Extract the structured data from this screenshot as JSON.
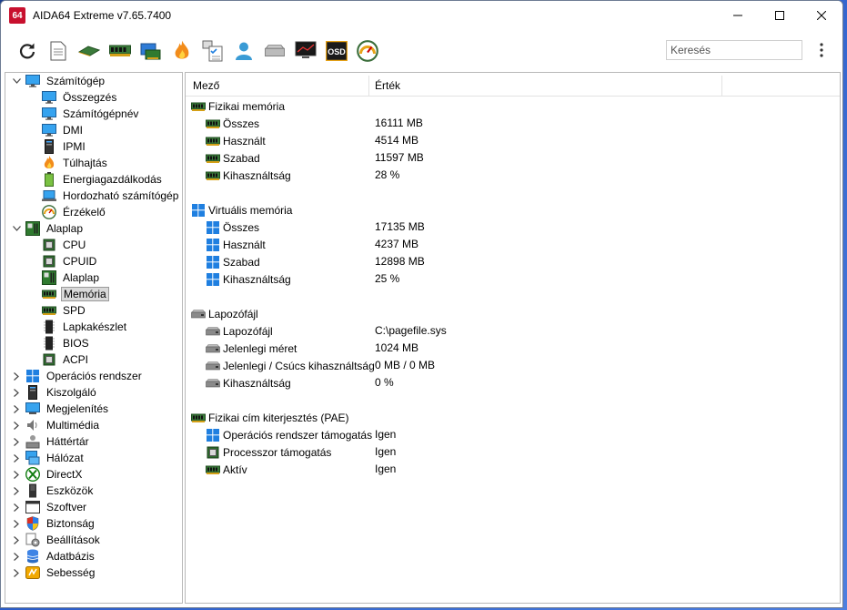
{
  "window": {
    "title": "AIDA64 Extreme v7.65.7400",
    "logo_text": "64"
  },
  "toolbar": {
    "buttons": [
      "refresh-icon",
      "report-icon",
      "motherboard-icon",
      "memory-icon",
      "network-card-icon",
      "flame-icon",
      "network-audit-icon",
      "user-icon",
      "drive-icon",
      "monitor-icon",
      "osd-icon",
      "gauge-icon"
    ],
    "search_placeholder": "Keresés"
  },
  "tree": {
    "items": [
      {
        "label": "Számítógép",
        "level": 0,
        "expand": "open",
        "icon": "computer-icon"
      },
      {
        "label": "Összegzés",
        "level": 1,
        "icon": "computer-icon"
      },
      {
        "label": "Számítógépnév",
        "level": 1,
        "icon": "computer-icon"
      },
      {
        "label": "DMI",
        "level": 1,
        "icon": "computer-icon"
      },
      {
        "label": "IPMI",
        "level": 1,
        "icon": "server-icon"
      },
      {
        "label": "Túlhajtás",
        "level": 1,
        "icon": "flame-icon"
      },
      {
        "label": "Energiagazdálkodás",
        "level": 1,
        "icon": "battery-icon"
      },
      {
        "label": "Hordozható számítógép",
        "level": 1,
        "icon": "laptop-icon"
      },
      {
        "label": "Érzékelő",
        "level": 1,
        "icon": "gauge-icon"
      },
      {
        "label": "Alaplap",
        "level": 0,
        "expand": "open",
        "icon": "motherboard-icon"
      },
      {
        "label": "CPU",
        "level": 1,
        "icon": "cpu-icon"
      },
      {
        "label": "CPUID",
        "level": 1,
        "icon": "cpu-icon"
      },
      {
        "label": "Alaplap",
        "level": 1,
        "icon": "motherboard-icon"
      },
      {
        "label": "Memória",
        "level": 1,
        "icon": "memory-icon",
        "selected": true
      },
      {
        "label": "SPD",
        "level": 1,
        "icon": "memory-icon"
      },
      {
        "label": "Lapkakészlet",
        "level": 1,
        "icon": "chip-icon"
      },
      {
        "label": "BIOS",
        "level": 1,
        "icon": "chip-icon"
      },
      {
        "label": "ACPI",
        "level": 1,
        "icon": "cpu-icon"
      },
      {
        "label": "Operációs rendszer",
        "level": 0,
        "expand": "closed",
        "icon": "windows-icon"
      },
      {
        "label": "Kiszolgáló",
        "level": 0,
        "expand": "closed",
        "icon": "server-icon"
      },
      {
        "label": "Megjelenítés",
        "level": 0,
        "expand": "closed",
        "icon": "monitor-icon"
      },
      {
        "label": "Multimédia",
        "level": 0,
        "expand": "closed",
        "icon": "speaker-icon"
      },
      {
        "label": "Háttértár",
        "level": 0,
        "expand": "closed",
        "icon": "disk-user-icon"
      },
      {
        "label": "Hálózat",
        "level": 0,
        "expand": "closed",
        "icon": "network-icon"
      },
      {
        "label": "DirectX",
        "level": 0,
        "expand": "closed",
        "icon": "xbox-icon"
      },
      {
        "label": "Eszközök",
        "level": 0,
        "expand": "closed",
        "icon": "device-icon"
      },
      {
        "label": "Szoftver",
        "level": 0,
        "expand": "closed",
        "icon": "window-icon"
      },
      {
        "label": "Biztonság",
        "level": 0,
        "expand": "closed",
        "icon": "shield-icon"
      },
      {
        "label": "Beállítások",
        "level": 0,
        "expand": "closed",
        "icon": "settings-icon"
      },
      {
        "label": "Adatbázis",
        "level": 0,
        "expand": "closed",
        "icon": "database-icon"
      },
      {
        "label": "Sebesség",
        "level": 0,
        "expand": "closed",
        "icon": "benchmark-icon"
      }
    ]
  },
  "detail": {
    "headers": {
      "field": "Mező",
      "value": "Érték"
    },
    "rows": [
      {
        "type": "group",
        "label": "Fizikai memória",
        "icon": "memory-icon"
      },
      {
        "type": "item",
        "label": "Összes",
        "value": "16111 MB",
        "icon": "memory-icon"
      },
      {
        "type": "item",
        "label": "Használt",
        "value": "4514 MB",
        "icon": "memory-icon"
      },
      {
        "type": "item",
        "label": "Szabad",
        "value": "11597 MB",
        "icon": "memory-icon"
      },
      {
        "type": "item",
        "label": "Kihasználtság",
        "value": "28 %",
        "icon": "memory-icon"
      },
      {
        "type": "blank"
      },
      {
        "type": "group",
        "label": "Virtuális memória",
        "icon": "windows-icon"
      },
      {
        "type": "item",
        "label": "Összes",
        "value": "17135 MB",
        "icon": "windows-icon"
      },
      {
        "type": "item",
        "label": "Használt",
        "value": "4237 MB",
        "icon": "windows-icon"
      },
      {
        "type": "item",
        "label": "Szabad",
        "value": "12898 MB",
        "icon": "windows-icon"
      },
      {
        "type": "item",
        "label": "Kihasználtság",
        "value": "25 %",
        "icon": "windows-icon"
      },
      {
        "type": "blank"
      },
      {
        "type": "group",
        "label": "Lapozófájl",
        "icon": "drive-icon"
      },
      {
        "type": "item",
        "label": "Lapozófájl",
        "value": "C:\\pagefile.sys",
        "icon": "drive-icon"
      },
      {
        "type": "item",
        "label": "Jelenlegi méret",
        "value": "1024 MB",
        "icon": "drive-icon"
      },
      {
        "type": "item",
        "label": "Jelenlegi / Csúcs kihasználtság",
        "value": "0 MB / 0 MB",
        "icon": "drive-icon"
      },
      {
        "type": "item",
        "label": "Kihasználtság",
        "value": "0 %",
        "icon": "drive-icon"
      },
      {
        "type": "blank"
      },
      {
        "type": "group",
        "label": "Fizikai cím kiterjesztés (PAE)",
        "icon": "memory-icon"
      },
      {
        "type": "item",
        "label": "Operációs rendszer támogatás",
        "value": "Igen",
        "icon": "windows-icon"
      },
      {
        "type": "item",
        "label": "Processzor támogatás",
        "value": "Igen",
        "icon": "cpu-icon"
      },
      {
        "type": "item",
        "label": "Aktív",
        "value": "Igen",
        "icon": "memory-icon"
      }
    ]
  }
}
